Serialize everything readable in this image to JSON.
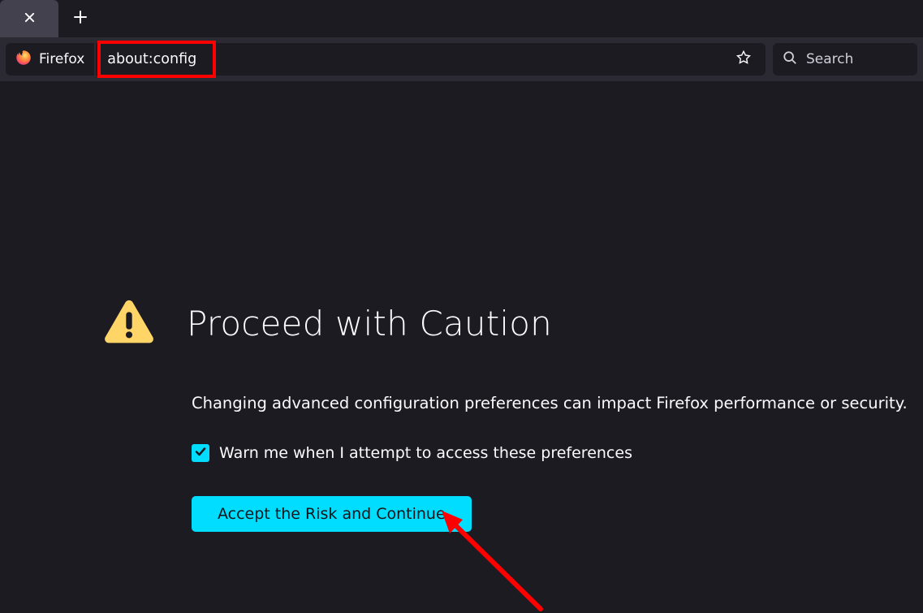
{
  "toolbar": {
    "identity_label": "Firefox",
    "url_value": "about:config",
    "search_placeholder": "Search"
  },
  "page": {
    "heading": "Proceed with Caution",
    "description": "Changing advanced configuration preferences can impact Firefox performance or security.",
    "checkbox_label": "Warn me when I attempt to access these preferences",
    "checkbox_checked": true,
    "accept_button": "Accept the Risk and Continue"
  },
  "annotation": {
    "highlight_target": "url",
    "arrow_target": "accept-button"
  }
}
